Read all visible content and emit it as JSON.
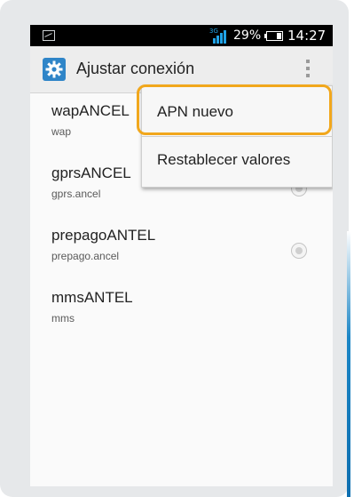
{
  "status_bar": {
    "network_type": "3G",
    "battery_percent": "29%",
    "battery_level": 0.29,
    "time": "14:27",
    "icons": [
      "image-icon",
      "signal-icon",
      "battery-icon"
    ]
  },
  "action_bar": {
    "title": "Ajustar conexión",
    "icon": "settings-gear-icon",
    "overflow_icon": "overflow-menu-icon"
  },
  "apn_list": [
    {
      "name": "wapANCEL",
      "apn": "wap"
    },
    {
      "name": "gprsANCEL",
      "apn": "gprs.ancel"
    },
    {
      "name": "prepagoANTEL",
      "apn": "prepago.ancel"
    },
    {
      "name": "mmsANTEL",
      "apn": "mms"
    }
  ],
  "overflow_menu": {
    "items": [
      {
        "label": "APN nuevo",
        "highlighted": true
      },
      {
        "label": "Restablecer valores",
        "highlighted": false
      }
    ]
  },
  "colors": {
    "highlight": "#f1a71c",
    "gear_background": "#2f85c8",
    "signal": "#1fa2e6"
  }
}
